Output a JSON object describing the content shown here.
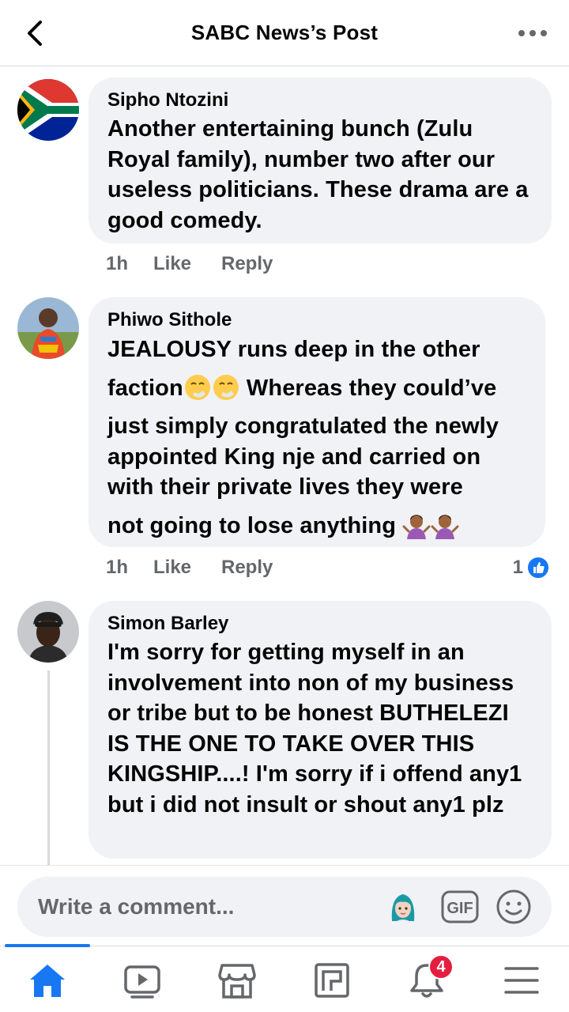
{
  "header": {
    "title": "SABC News’s Post",
    "back_icon": "chevron-left-icon",
    "more_icon": "more-horizontal-icon"
  },
  "comments": [
    {
      "author": "Sipho Ntozini",
      "text": "Another entertaining bunch (Zulu Royal family), number two after our useless politicians. These drama are a good comedy.",
      "time": "1h",
      "like_label": "Like",
      "reply_label": "Reply"
    },
    {
      "author": "Phiwo Sithole",
      "text_line1": "JEALOUSY runs deep in the other",
      "text_line2": "faction",
      "text_line2b": " Whereas they could’ve",
      "text_line3": "just simply congratulated the newly appointed King nje and carried on with their private lives they were",
      "text_line4": "not going to lose anything",
      "time": "1h",
      "like_label": "Like",
      "reply_label": "Reply",
      "reaction_count": "1",
      "emoji_a": "sneezing-face-emoji",
      "emoji_b": "person-shrugging-emoji"
    },
    {
      "author": "Simon Barley",
      "text": "I'm sorry for getting myself in an involvement into non of my business or tribe but to be honest BUTHELEZI IS THE ONE TO TAKE OVER THIS KINGSHIP....! I'm sorry if i offend any1 but i did not insult or shout any1 plz"
    }
  ],
  "composer": {
    "placeholder": "Write a comment...",
    "avatar_icon": "avatar-sticker-icon",
    "gif_label": "GIF",
    "emoji_icon": "smiley-icon"
  },
  "nav": {
    "items": [
      "home-icon",
      "watch-icon",
      "marketplace-icon",
      "pages-icon",
      "notifications-icon",
      "menu-icon"
    ],
    "notification_count": "4"
  },
  "colors": {
    "brand": "#1877f2",
    "bubble": "#f0f2f5",
    "meta": "#65676b",
    "badge": "#e41e3f"
  }
}
